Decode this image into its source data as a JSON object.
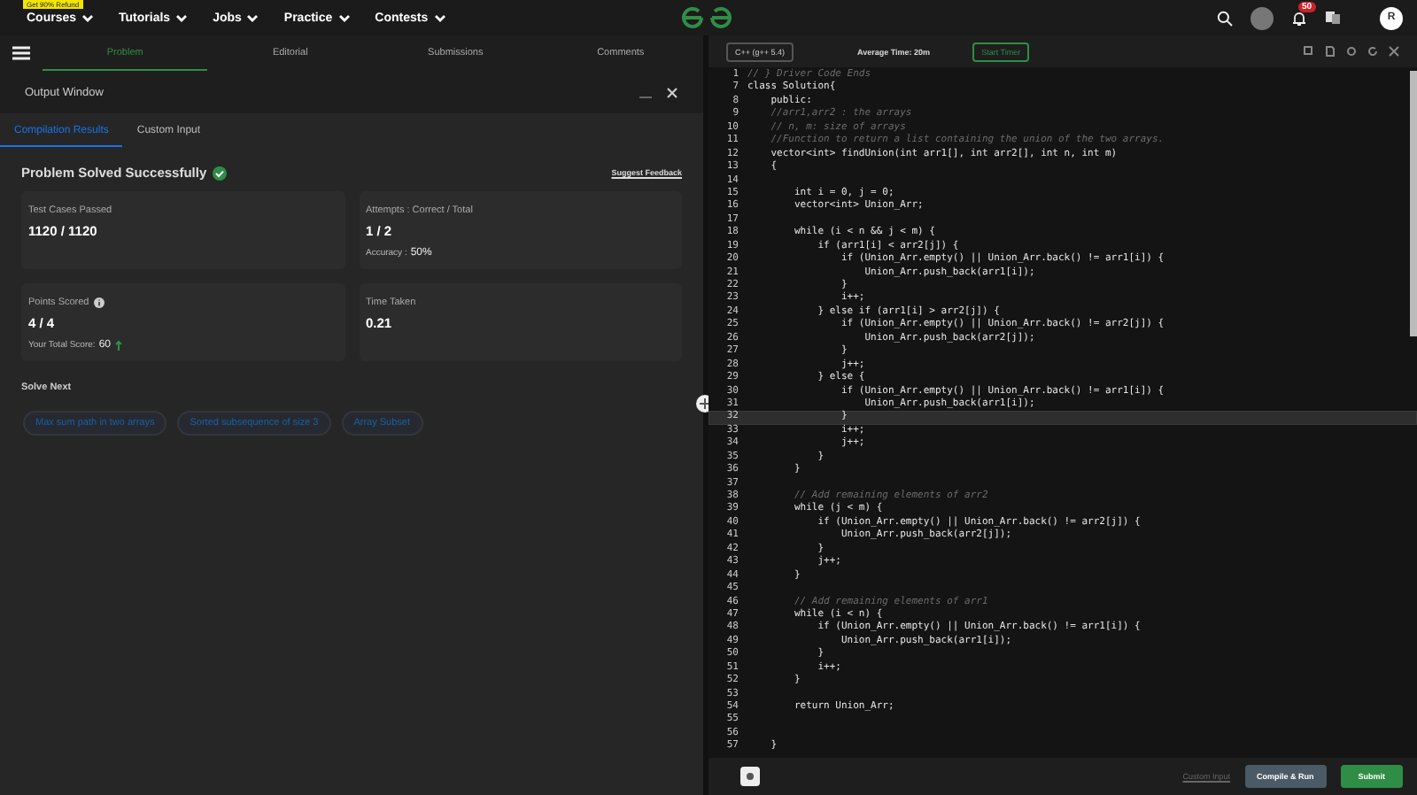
{
  "nav": {
    "promo": "Get 90% Refund",
    "items": [
      "Courses",
      "Tutorials",
      "Jobs",
      "Practice",
      "Contests"
    ],
    "notification_count": "50",
    "avatar": "R"
  },
  "problem_tabs": [
    {
      "label": "Problem",
      "selected": true
    },
    {
      "label": "Editorial",
      "selected": false
    },
    {
      "label": "Submissions",
      "selected": false
    },
    {
      "label": "Comments",
      "selected": false
    }
  ],
  "output_window": {
    "title": "Output Window",
    "tabs": [
      {
        "label": "Compilation Results",
        "selected": true
      },
      {
        "label": "Custom Input",
        "selected": false
      }
    ],
    "status": "Problem Solved Successfully",
    "feedback_link": "Suggest Feedback",
    "cards": [
      {
        "label": "Test Cases Passed",
        "value": "1120 / 1120"
      },
      {
        "label": "Attempts : Correct / Total",
        "value": "1 / 2",
        "sub_label": "Accuracy :",
        "sub_value": "50%"
      },
      {
        "label": "Points Scored",
        "value": "4 / 4",
        "sub_label": "Your Total Score:",
        "sub_value": "60",
        "info": true,
        "trend_up": true
      },
      {
        "label": "Time Taken",
        "value": "0.21"
      }
    ],
    "solve_next_title": "Solve Next",
    "solve_next": [
      "Max sum path in two arrays",
      "Sorted subsequence of size 3",
      "Array Subset"
    ]
  },
  "editor": {
    "language": "C++ (g++ 5.4)",
    "average_time": "Average Time: 20m",
    "timer_button": "Start Timer",
    "lines": [
      {
        "num": "1",
        "code": "// } Driver Code Ends",
        "kind": "comment",
        "current": false
      },
      {
        "num": "7",
        "code": "class Solution{",
        "kind": "code",
        "current": false
      },
      {
        "num": "8",
        "code": "    public:",
        "kind": "code",
        "current": false
      },
      {
        "num": "9",
        "code": "    //arr1,arr2 : the arrays",
        "kind": "comment",
        "current": false
      },
      {
        "num": "10",
        "code": "    // n, m: size of arrays",
        "kind": "comment",
        "current": false
      },
      {
        "num": "11",
        "code": "    //Function to return a list containing the union of the two arrays.",
        "kind": "comment",
        "current": false
      },
      {
        "num": "12",
        "code": "    vector<int> findUnion(int arr1[], int arr2[], int n, int m)",
        "kind": "code",
        "current": false
      },
      {
        "num": "13",
        "code": "    {",
        "kind": "code",
        "current": false
      },
      {
        "num": "14",
        "current": false
      },
      {
        "num": "15",
        "code": "        int i = 0, j = 0;",
        "kind": "code",
        "current": false
      },
      {
        "num": "16",
        "code": "        vector<int> Union_Arr;",
        "kind": "code",
        "current": false
      },
      {
        "num": "17",
        "current": false
      },
      {
        "num": "18",
        "code": "        while (i < n && j < m) {",
        "kind": "code",
        "current": false
      },
      {
        "num": "19",
        "code": "            if (arr1[i] < arr2[j]) {",
        "kind": "code",
        "current": false
      },
      {
        "num": "20",
        "code": "                if (Union_Arr.empty() || Union_Arr.back() != arr1[i]) {",
        "kind": "code",
        "current": false
      },
      {
        "num": "21",
        "code": "                    Union_Arr.push_back(arr1[i]);",
        "kind": "code",
        "current": false
      },
      {
        "num": "22",
        "code": "                }",
        "kind": "code",
        "current": false
      },
      {
        "num": "23",
        "code": "                i++;",
        "kind": "code",
        "current": false
      },
      {
        "num": "24",
        "code": "            } else if (arr1[i] > arr2[j]) {",
        "kind": "code",
        "current": false
      },
      {
        "num": "25",
        "code": "                if (Union_Arr.empty() || Union_Arr.back() != arr2[j]) {",
        "kind": "code",
        "current": false
      },
      {
        "num": "26",
        "code": "                    Union_Arr.push_back(arr2[j]);",
        "kind": "code",
        "current": false
      },
      {
        "num": "27",
        "code": "                }",
        "kind": "code",
        "current": false
      },
      {
        "num": "28",
        "code": "                j++;",
        "kind": "code",
        "current": false
      },
      {
        "num": "29",
        "code": "            } else {",
        "kind": "code",
        "current": false
      },
      {
        "num": "30",
        "code": "                if (Union_Arr.empty() || Union_Arr.back() != arr1[i]) {",
        "kind": "code",
        "current": false
      },
      {
        "num": "31",
        "code": "                    Union_Arr.push_back(arr1[i]);",
        "kind": "code",
        "current": false
      },
      {
        "num": "32",
        "code": "                }",
        "kind": "code",
        "current": true
      },
      {
        "num": "33",
        "code": "                i++;",
        "kind": "code",
        "current": false
      },
      {
        "num": "34",
        "code": "                j++;",
        "kind": "code",
        "current": false
      },
      {
        "num": "35",
        "code": "            }",
        "kind": "code",
        "current": false
      },
      {
        "num": "36",
        "code": "        }",
        "kind": "code",
        "current": false
      },
      {
        "num": "37",
        "current": false
      },
      {
        "num": "38",
        "code": "        // Add remaining elements of arr2",
        "kind": "comment",
        "current": false
      },
      {
        "num": "39",
        "code": "        while (j < m) {",
        "kind": "code",
        "current": false
      },
      {
        "num": "40",
        "code": "            if (Union_Arr.empty() || Union_Arr.back() != arr2[j]) {",
        "kind": "code",
        "current": false
      },
      {
        "num": "41",
        "code": "                Union_Arr.push_back(arr2[j]);",
        "kind": "code",
        "current": false
      },
      {
        "num": "42",
        "code": "            }",
        "kind": "code",
        "current": false
      },
      {
        "num": "43",
        "code": "            j++;",
        "kind": "code",
        "current": false
      },
      {
        "num": "44",
        "code": "        }",
        "kind": "code",
        "current": false
      },
      {
        "num": "45",
        "current": false
      },
      {
        "num": "46",
        "code": "        // Add remaining elements of arr1",
        "kind": "comment",
        "current": false
      },
      {
        "num": "47",
        "code": "        while (i < n) {",
        "kind": "code",
        "current": false
      },
      {
        "num": "48",
        "code": "            if (Union_Arr.empty() || Union_Arr.back() != arr1[i]) {",
        "kind": "code",
        "current": false
      },
      {
        "num": "49",
        "code": "                Union_Arr.push_back(arr1[i]);",
        "kind": "code",
        "current": false
      },
      {
        "num": "50",
        "code": "            }",
        "kind": "code",
        "current": false
      },
      {
        "num": "51",
        "code": "            i++;",
        "kind": "code",
        "current": false
      },
      {
        "num": "52",
        "code": "        }",
        "kind": "code",
        "current": false
      },
      {
        "num": "53",
        "current": false
      },
      {
        "num": "54",
        "code": "        return Union_Arr;",
        "kind": "code",
        "current": false
      },
      {
        "num": "55",
        "current": false
      },
      {
        "num": "56",
        "current": false
      },
      {
        "num": "57",
        "code": "    }",
        "kind": "code",
        "current": false
      }
    ],
    "custom_input_link": "Custom Input",
    "compile_button": "Compile & Run",
    "submit_button": "Submit"
  }
}
